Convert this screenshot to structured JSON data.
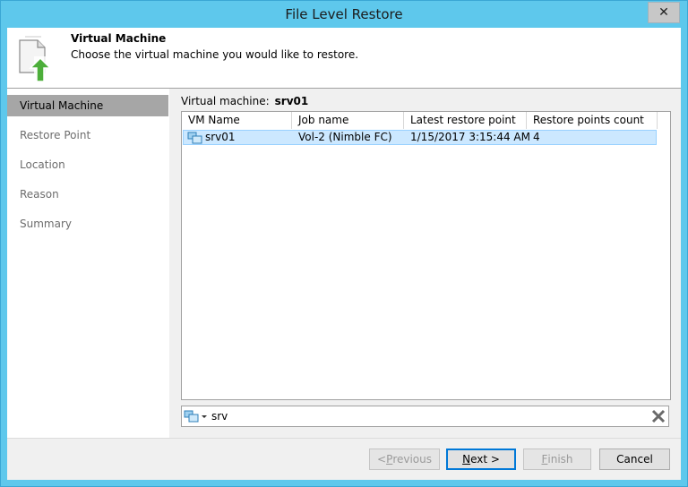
{
  "window": {
    "title": "File Level Restore",
    "close_glyph": "✕"
  },
  "header": {
    "title": "Virtual Machine",
    "subtitle": "Choose the virtual machine you would like to restore.",
    "icon": "restore-document-icon"
  },
  "nav": {
    "items": [
      {
        "label": "Virtual Machine",
        "active": true
      },
      {
        "label": "Restore Point",
        "active": false
      },
      {
        "label": "Location",
        "active": false
      },
      {
        "label": "Reason",
        "active": false
      },
      {
        "label": "Summary",
        "active": false
      }
    ]
  },
  "vm": {
    "label": "Virtual machine:",
    "value": "srv01"
  },
  "grid": {
    "columns": [
      "VM Name",
      "Job name",
      "Latest restore point",
      "Restore points count"
    ],
    "rows": [
      {
        "vm_name": "srv01",
        "job_name": "Vol-2 (Nimble FC)",
        "latest": "1/15/2017 3:15:44 AM",
        "count": "4"
      }
    ]
  },
  "search": {
    "value": "srv",
    "filter_icon": "vm-filter-icon",
    "clear_icon": "clear-icon"
  },
  "buttons": {
    "previous_prefix": "< ",
    "previous_key": "P",
    "previous_rest": "revious",
    "next_key": "N",
    "next_rest": "ext >",
    "finish_key": "F",
    "finish_rest": "inish",
    "cancel": "Cancel"
  },
  "colors": {
    "accent": "#5ec8ec",
    "selection": "#cce8ff",
    "nav_active": "#a6a6a6"
  }
}
